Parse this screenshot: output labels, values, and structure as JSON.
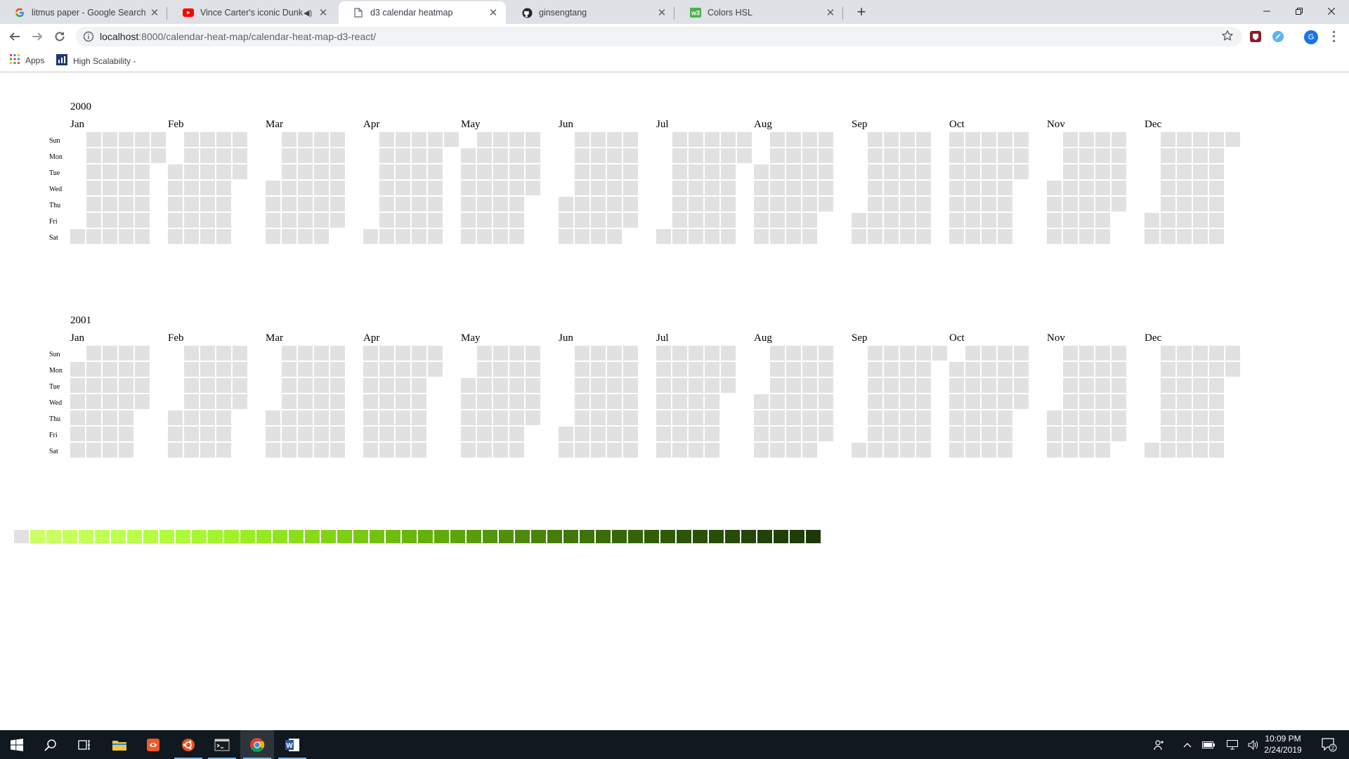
{
  "browser": {
    "tabs": [
      {
        "title": "litmus paper - Google Search",
        "icon": "google-icon",
        "active": false
      },
      {
        "title": "Vince Carter's iconic Dunk Co",
        "icon": "youtube-icon",
        "active": false,
        "audio": true
      },
      {
        "title": "d3 calendar heatmap",
        "icon": "page-icon",
        "active": true
      },
      {
        "title": "ginsengtang",
        "icon": "github-icon",
        "active": false
      },
      {
        "title": "Colors HSL",
        "icon": "w3schools-icon",
        "active": false
      }
    ],
    "url_host": "localhost",
    "url_rest": ":8000/calendar-heat-map/calendar-heat-map-d3-react/",
    "bookmarks": [
      {
        "label": "Apps",
        "icon": "apps-grid-icon"
      },
      {
        "label": "High Scalability -",
        "icon": "highscalability-icon"
      }
    ],
    "profile_initial": "G"
  },
  "calendar": {
    "years": [
      "2000",
      "2001"
    ],
    "months": [
      "Jan",
      "Feb",
      "Mar",
      "Apr",
      "May",
      "Jun",
      "Jul",
      "Aug",
      "Sep",
      "Oct",
      "Nov",
      "Dec"
    ],
    "weekdays": [
      "Sun",
      "Mon",
      "Tue",
      "Wed",
      "Thu",
      "Fri",
      "Sat"
    ],
    "empty_cell_color": "#e1e1e1",
    "legend_colors": [
      "#e1e1e1",
      "#ccff66",
      "#c9ff61",
      "#c6ff5c",
      "#c3ff57",
      "#c0ff52",
      "#bcff4c",
      "#b8ff47",
      "#b4fe42",
      "#b0fc3d",
      "#acfa38",
      "#a8f733",
      "#a3f42e",
      "#9ff12a",
      "#9aed25",
      "#95e921",
      "#90e41d",
      "#8bdf1a",
      "#86da17",
      "#81d414",
      "#7ccf12",
      "#78c910",
      "#73c30e",
      "#6ebd0d",
      "#6ab70c",
      "#65b10b",
      "#61aa0a",
      "#5ca40a",
      "#589d09",
      "#549709",
      "#509008",
      "#4c8a08",
      "#488408",
      "#447e07",
      "#407807",
      "#3d7307",
      "#3a6d07",
      "#376807",
      "#346307",
      "#315e07",
      "#2f5a07",
      "#2c5507",
      "#2a5107",
      "#284d07",
      "#264a07",
      "#244607",
      "#224307",
      "#204007",
      "#1e3d07",
      "#1c3a07"
    ]
  },
  "taskbar": {
    "items": [
      "start-icon",
      "search-icon",
      "task-view-icon",
      "file-explorer-icon",
      "app-icon",
      "ubuntu-icon",
      "terminal-icon",
      "chrome-icon",
      "word-icon"
    ],
    "time": "10:09 PM",
    "date": "2/24/2019",
    "notification_count": "2"
  }
}
